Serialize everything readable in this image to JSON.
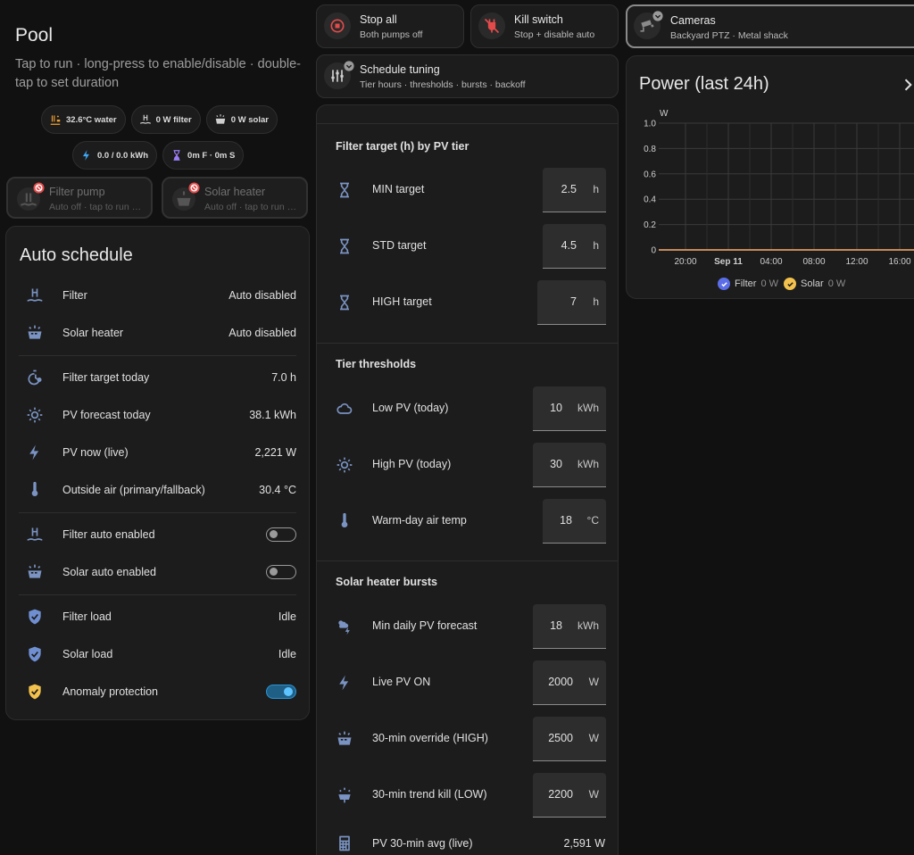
{
  "pool": {
    "title": "Pool",
    "subtitle": "Tap to run · long-press to enable/disable · double-tap to set duration",
    "chips": [
      {
        "icon": "pool-heater-icon",
        "label": "32.6°C water",
        "color": "#f0a030"
      },
      {
        "icon": "pool-icon",
        "label": "0 W filter",
        "color": "#cfcfcf"
      },
      {
        "icon": "solar-panel-icon",
        "label": "0 W solar",
        "color": "#cfcfcf"
      },
      {
        "icon": "lightning-icon",
        "label": "0.0 / 0.0 kWh",
        "color": "#3fa9f5"
      },
      {
        "icon": "hourglass-icon",
        "label": "0m F · 0m S",
        "color": "#9b7cf5"
      }
    ],
    "tiles": [
      {
        "title": "Filter pump",
        "subtitle": "Auto off · tap to run …"
      },
      {
        "title": "Solar heater",
        "subtitle": "Auto off · tap to run …"
      }
    ]
  },
  "auto": {
    "title": "Auto schedule",
    "rows": [
      {
        "label": "Filter",
        "value": "Auto disabled",
        "icon": "pool-icon"
      },
      {
        "label": "Solar heater",
        "value": "Auto disabled",
        "icon": "solar-panel-icon"
      },
      {
        "label": "Filter target today",
        "value": "7.0 h",
        "icon": "timer-cog-icon"
      },
      {
        "label": "PV forecast today",
        "value": "38.1 kWh",
        "icon": "sun-icon"
      },
      {
        "label": "PV now (live)",
        "value": "2,221 W",
        "icon": "lightning-icon"
      },
      {
        "label": "Outside air (primary/fallback)",
        "value": "30.4 °C",
        "icon": "thermometer-icon"
      },
      {
        "label": "Filter auto enabled",
        "icon": "pool-icon",
        "toggle": false
      },
      {
        "label": "Solar auto enabled",
        "icon": "solar-panel-icon",
        "toggle": false
      },
      {
        "label": "Filter load",
        "value": "Idle",
        "icon": "shield-check-icon"
      },
      {
        "label": "Solar load",
        "value": "Idle",
        "icon": "shield-check-icon"
      },
      {
        "label": "Anomaly protection",
        "icon": "shield-check-icon",
        "toggle": true
      }
    ]
  },
  "buttons": {
    "stop_all": {
      "title": "Stop all",
      "subtitle": "Both pumps off",
      "icon": "stop-circle-icon"
    },
    "kill_switch": {
      "title": "Kill switch",
      "subtitle": "Stop + disable auto",
      "icon": "power-plug-off-icon"
    },
    "cameras": {
      "title": "Cameras",
      "subtitle": "Backyard PTZ · Metal shack",
      "icon": "cctv-icon"
    },
    "schedule_tuning": {
      "title": "Schedule tuning",
      "subtitle": "Tier hours · thresholds · bursts · backoff",
      "icon": "tune-icon"
    }
  },
  "tuning": {
    "sections": [
      {
        "title": "Filter target (h) by PV tier",
        "rows": [
          {
            "label": "MIN target",
            "value": "2.5",
            "unit": "h",
            "icon": "hourglass-icon"
          },
          {
            "label": "STD target",
            "value": "4.5",
            "unit": "h",
            "icon": "hourglass-icon"
          },
          {
            "label": "HIGH target",
            "value": "7",
            "unit": "h",
            "icon": "hourglass-icon"
          }
        ]
      },
      {
        "title": "Tier thresholds",
        "rows": [
          {
            "label": "Low PV (today)",
            "value": "10",
            "unit": "kWh",
            "icon": "cloud-icon"
          },
          {
            "label": "High PV (today)",
            "value": "30",
            "unit": "kWh",
            "icon": "sun-icon"
          },
          {
            "label": "Warm-day air temp",
            "value": "18",
            "unit": "°C",
            "icon": "thermometer-icon"
          }
        ]
      },
      {
        "title": "Solar heater bursts",
        "rows": [
          {
            "label": "Min daily PV forecast",
            "value": "18",
            "unit": "kWh",
            "icon": "weather-partly-lightning-icon"
          },
          {
            "label": "Live PV ON",
            "value": "2000",
            "unit": "W",
            "icon": "lightning-icon"
          },
          {
            "label": "30-min override (HIGH)",
            "value": "2500",
            "unit": "W",
            "icon": "solar-panel-icon"
          },
          {
            "label": "30-min trend kill (LOW)",
            "value": "2200",
            "unit": "W",
            "icon": "solar-power-icon"
          }
        ]
      }
    ],
    "avg": {
      "label": "PV 30-min avg (live)",
      "value": "2,591 W",
      "icon": "calculator-icon"
    }
  },
  "power": {
    "title": "Power (last 24h)",
    "legend": [
      {
        "name": "Filter",
        "value": "0 W",
        "color": "#5b6ee8"
      },
      {
        "name": "Solar",
        "value": "0 W",
        "color": "#f2c14e"
      }
    ]
  },
  "chart_data": {
    "type": "line",
    "title": "Power (last 24h)",
    "ylabel": "W",
    "xlabel": "",
    "x_ticks": [
      "20:00",
      "Sep 11",
      "04:00",
      "08:00",
      "12:00",
      "16:00"
    ],
    "y_ticks": [
      "0",
      "0.2",
      "0.4",
      "0.6",
      "0.8",
      "1.0"
    ],
    "ylim": [
      0,
      1
    ],
    "grid": true,
    "legend_position": "bottom",
    "series": [
      {
        "name": "Filter",
        "color": "#5b6ee8",
        "values": [
          0,
          0,
          0,
          0,
          0,
          0,
          0
        ]
      },
      {
        "name": "Solar",
        "color": "#f2a14e",
        "values": [
          0,
          0,
          0,
          0,
          0,
          0,
          0
        ]
      }
    ]
  }
}
